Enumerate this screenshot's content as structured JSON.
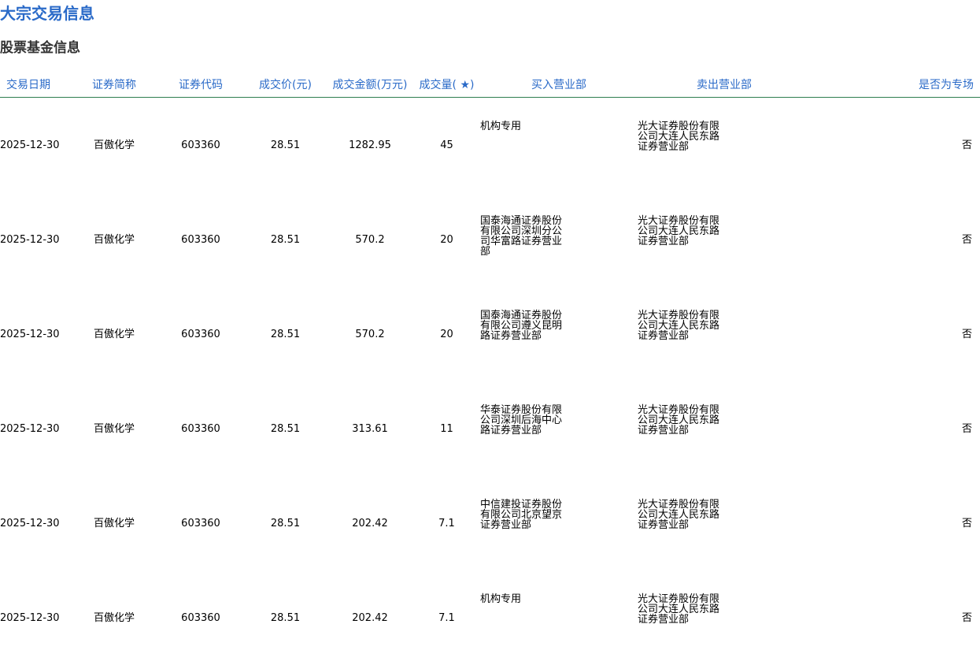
{
  "page": {
    "title": "大宗交易信息",
    "section_title": "股票基金信息"
  },
  "table": {
    "headers": [
      "交易日期",
      "证券简称",
      "证券代码",
      "成交价(元)",
      "成交金额(万元)",
      "成交量( ★)",
      "买入营业部",
      "卖出营业部",
      "是否为专场"
    ],
    "rows": [
      [
        "2025-12-30",
        "百傲化学",
        "603360",
        "28.51",
        "1282.95",
        "45",
        "机构专用",
        "光大证券股份有限公司大连人民东路证券营业部",
        "否"
      ],
      [
        "2025-12-30",
        "百傲化学",
        "603360",
        "28.51",
        "570.2",
        "20",
        "国泰海通证券股份有限公司深圳分公司华富路证券营业部",
        "光大证券股份有限公司大连人民东路证券营业部",
        "否"
      ],
      [
        "2025-12-30",
        "百傲化学",
        "603360",
        "28.51",
        "570.2",
        "20",
        "国泰海通证券股份有限公司遵义昆明路证券营业部",
        "光大证券股份有限公司大连人民东路证券营业部",
        "否"
      ],
      [
        "2025-12-30",
        "百傲化学",
        "603360",
        "28.51",
        "313.61",
        "11",
        "华泰证券股份有限公司深圳后海中心路证券营业部",
        "光大证券股份有限公司大连人民东路证券营业部",
        "否"
      ],
      [
        "2025-12-30",
        "百傲化学",
        "603360",
        "28.51",
        "202.42",
        "7.1",
        "中信建投证券股份有限公司北京望京证券营业部",
        "光大证券股份有限公司大连人民东路证券营业部",
        "否"
      ],
      [
        "2025-12-30",
        "百傲化学",
        "603360",
        "28.51",
        "202.42",
        "7.1",
        "机构专用",
        "光大证券股份有限公司大连人民东路证券营业部",
        "否"
      ]
    ]
  }
}
